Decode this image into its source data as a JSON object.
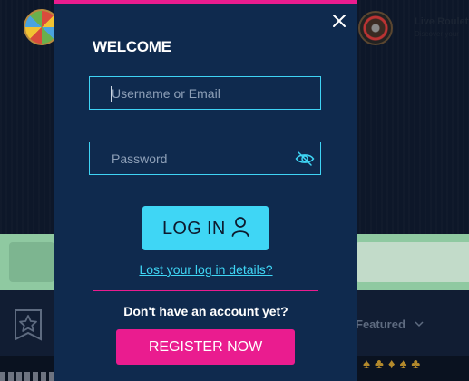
{
  "background": {
    "promo": {
      "title": "Live Roulett",
      "subtitle": "Discover your"
    },
    "lobby": {
      "featured_label": "Featured"
    },
    "suits": "♠♣♦♠♣"
  },
  "modal": {
    "title": "WELCOME",
    "username": {
      "placeholder": "Username or Email",
      "value": ""
    },
    "password": {
      "placeholder": "Password",
      "value": ""
    },
    "login_label": "LOG IN",
    "lost_details_link": "Lost your log in details?",
    "no_account_text": "Don't have an account yet?",
    "register_label": "REGISTER NOW",
    "icons": {
      "close": "close-icon",
      "password_toggle": "eye-slash-icon",
      "login": "user-icon"
    }
  },
  "colors": {
    "modal_bg": "#0f2a4e",
    "accent_cyan": "#3fd6f5",
    "accent_pink": "#ea1c8f",
    "promo_strip": "#8fc9a1"
  }
}
